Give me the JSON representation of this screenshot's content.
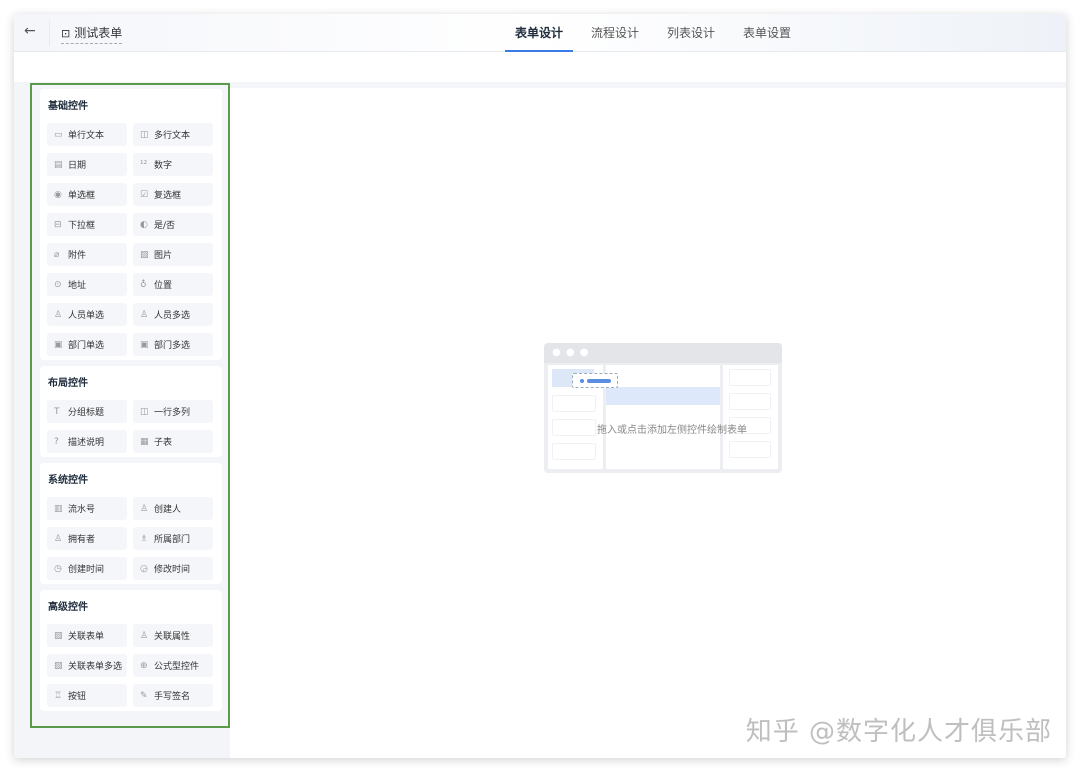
{
  "header": {
    "back_icon": "arrow-left-icon",
    "title": "测试表单",
    "tabs": [
      {
        "label": "表单设计",
        "active": true
      },
      {
        "label": "流程设计"
      },
      {
        "label": "列表设计"
      },
      {
        "label": "表单设置"
      }
    ]
  },
  "sections": [
    {
      "title": "基础控件",
      "items": [
        {
          "icon": "▭",
          "label": "单行文本"
        },
        {
          "icon": "◫",
          "label": "多行文本"
        },
        {
          "icon": "▤",
          "label": "日期"
        },
        {
          "icon": "¹²",
          "label": "数字"
        },
        {
          "icon": "◉",
          "label": "单选框"
        },
        {
          "icon": "☑",
          "label": "复选框"
        },
        {
          "icon": "⊟",
          "label": "下拉框"
        },
        {
          "icon": "◐",
          "label": "是/否"
        },
        {
          "icon": "⌀",
          "label": "附件"
        },
        {
          "icon": "▨",
          "label": "图片"
        },
        {
          "icon": "⊙",
          "label": "地址"
        },
        {
          "icon": "♁",
          "label": "位置"
        },
        {
          "icon": "♙",
          "label": "人员单选"
        },
        {
          "icon": "♙",
          "label": "人员多选"
        },
        {
          "icon": "▣",
          "label": "部门单选"
        },
        {
          "icon": "▣",
          "label": "部门多选"
        }
      ]
    },
    {
      "title": "布局控件",
      "items": [
        {
          "icon": "T",
          "label": "分组标题"
        },
        {
          "icon": "◫",
          "label": "一行多列"
        },
        {
          "icon": "?",
          "label": "描述说明"
        },
        {
          "icon": "▦",
          "label": "子表"
        }
      ]
    },
    {
      "title": "系统控件",
      "items": [
        {
          "icon": "▥",
          "label": "流水号"
        },
        {
          "icon": "♙",
          "label": "创建人"
        },
        {
          "icon": "♙",
          "label": "拥有者"
        },
        {
          "icon": "♗",
          "label": "所属部门"
        },
        {
          "icon": "◷",
          "label": "创建时间"
        },
        {
          "icon": "◶",
          "label": "修改时间"
        }
      ]
    },
    {
      "title": "高级控件",
      "items": [
        {
          "icon": "▧",
          "label": "关联表单"
        },
        {
          "icon": "♙",
          "label": "关联属性"
        },
        {
          "icon": "▧",
          "label": "关联表单多选"
        },
        {
          "icon": "⊕",
          "label": "公式型控件"
        },
        {
          "icon": "♖",
          "label": "按钮"
        },
        {
          "icon": "✎",
          "label": "手写签名"
        }
      ]
    }
  ],
  "canvas": {
    "hint": "拖入或点击添加左侧控件绘制表单"
  },
  "watermark": "知乎 @数字化人才俱乐部"
}
